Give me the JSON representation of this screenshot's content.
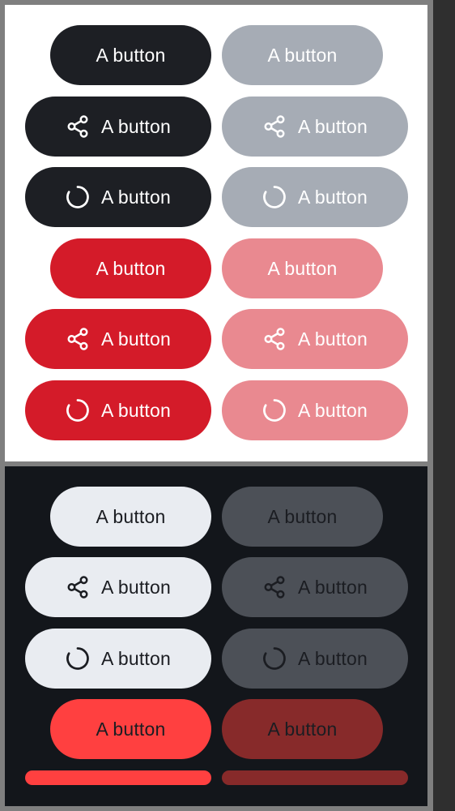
{
  "button_label": "A button",
  "light_panel": {
    "rows": [
      {
        "left": {
          "label": "A button",
          "icon": null
        },
        "right": {
          "label": "A button",
          "icon": null
        }
      },
      {
        "left": {
          "label": "A button",
          "icon": "share-icon"
        },
        "right": {
          "label": "A button",
          "icon": "share-icon"
        }
      },
      {
        "left": {
          "label": "A button",
          "icon": "spinner-icon"
        },
        "right": {
          "label": "A button",
          "icon": "spinner-icon"
        }
      },
      {
        "left": {
          "label": "A button",
          "icon": null
        },
        "right": {
          "label": "A button",
          "icon": null
        }
      },
      {
        "left": {
          "label": "A button",
          "icon": "share-icon"
        },
        "right": {
          "label": "A button",
          "icon": "share-icon"
        }
      },
      {
        "left": {
          "label": "A button",
          "icon": "spinner-icon"
        },
        "right": {
          "label": "A button",
          "icon": "spinner-icon"
        }
      }
    ]
  },
  "dark_panel": {
    "rows": [
      {
        "left": {
          "label": "A button",
          "icon": null
        },
        "right": {
          "label": "A button",
          "icon": null
        }
      },
      {
        "left": {
          "label": "A button",
          "icon": "share-icon"
        },
        "right": {
          "label": "A button",
          "icon": "share-icon"
        }
      },
      {
        "left": {
          "label": "A button",
          "icon": "spinner-icon"
        },
        "right": {
          "label": "A button",
          "icon": "spinner-icon"
        }
      },
      {
        "left": {
          "label": "A button",
          "icon": null
        },
        "right": {
          "label": "A button",
          "icon": null
        }
      }
    ]
  },
  "colors": {
    "dark_primary": "#1d1f24",
    "dark_primary_disabled": "#a6acb5",
    "red_primary": "#d41b29",
    "red_primary_disabled": "#e98990",
    "light_primary": "#e9ecf1",
    "light_primary_disabled": "#4c5057",
    "bright_red": "#ff4040",
    "bright_red_disabled": "#872a2a"
  }
}
